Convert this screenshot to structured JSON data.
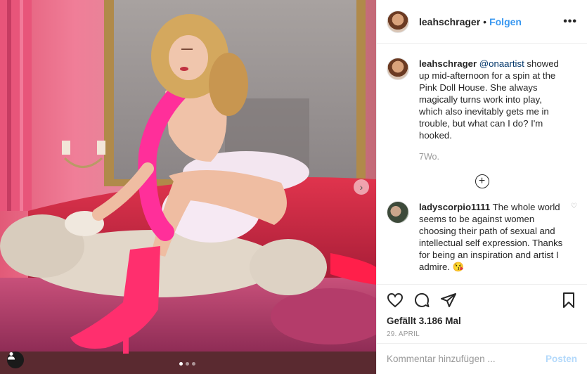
{
  "post": {
    "username": "leahschrager",
    "separator": "•",
    "follow_label": "Folgen",
    "more_label": "•••"
  },
  "caption": {
    "username": "leahschrager",
    "mention": "@onaartist",
    "text": " showed up mid-afternoon for a spin at the Pink Doll House. She always magically turns work into play, which also inevitably gets me in trouble, but what can I do? I'm hooked.",
    "time": "7Wo."
  },
  "comment": {
    "username": "ladyscorpio1111",
    "text": " The whole world seems to be against women choosing their path of sexual and intellectual self expression. Thanks for being an inspiration and artist I admire. 😘"
  },
  "stats": {
    "likes": "Gefällt 3.186 Mal",
    "date": "29. APRIL"
  },
  "composer": {
    "placeholder": "Kommentar hinzufügen ...",
    "post_label": "Posten"
  },
  "icons": {
    "like": "heart-icon",
    "comment": "comment-icon",
    "share": "share-icon",
    "save": "bookmark-icon",
    "load_more": "plus-circle-icon",
    "next": "chevron-right-icon",
    "user_tags": "user-icon"
  },
  "colors": {
    "accent": "#3897f0",
    "disabled_post": "#b3d9fb",
    "muted": "#999999"
  }
}
